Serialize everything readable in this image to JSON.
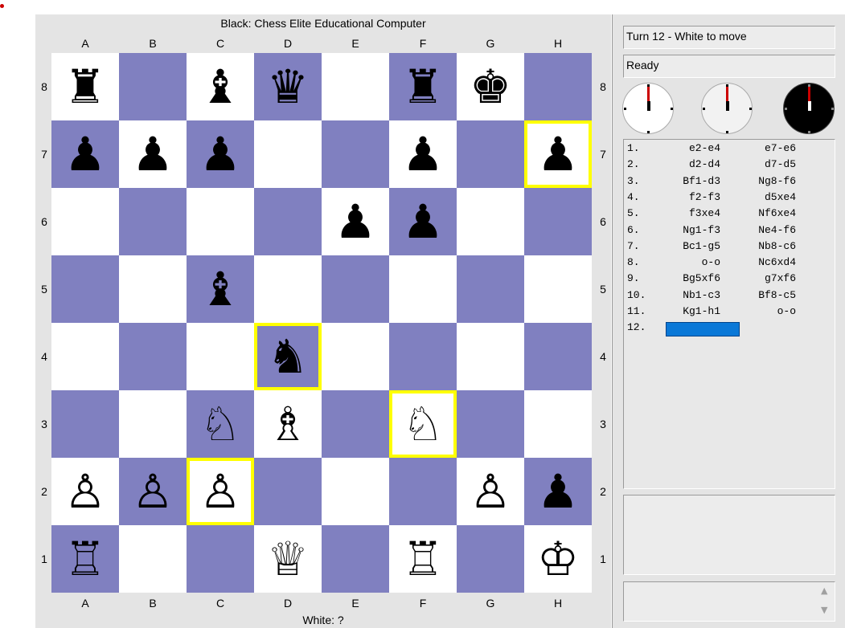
{
  "board": {
    "top_title": "Black: Chess Elite Educational Computer",
    "bottom_title": "White: ?",
    "files": [
      "A",
      "B",
      "C",
      "D",
      "E",
      "F",
      "G",
      "H"
    ],
    "ranks": [
      "8",
      "7",
      "6",
      "5",
      "4",
      "3",
      "2",
      "1"
    ],
    "colors": {
      "light": "#ffffff",
      "dark": "#8080c0",
      "highlight": "#ffff00"
    },
    "highlighted_squares": [
      "h7",
      "d4",
      "f3",
      "c2"
    ],
    "pieces": [
      {
        "square": "a8",
        "glyph": "♜",
        "piece": "black-rook"
      },
      {
        "square": "c8",
        "glyph": "♝",
        "piece": "black-bishop"
      },
      {
        "square": "d8",
        "glyph": "♛",
        "piece": "black-queen"
      },
      {
        "square": "f8",
        "glyph": "♜",
        "piece": "black-rook"
      },
      {
        "square": "g8",
        "glyph": "♚",
        "piece": "black-king"
      },
      {
        "square": "a7",
        "glyph": "♟",
        "piece": "black-pawn"
      },
      {
        "square": "b7",
        "glyph": "♟",
        "piece": "black-pawn"
      },
      {
        "square": "c7",
        "glyph": "♟",
        "piece": "black-pawn"
      },
      {
        "square": "f7",
        "glyph": "♟",
        "piece": "black-pawn"
      },
      {
        "square": "h7",
        "glyph": "♟",
        "piece": "black-pawn"
      },
      {
        "square": "e6",
        "glyph": "♟",
        "piece": "black-pawn"
      },
      {
        "square": "f6",
        "glyph": "♟",
        "piece": "black-pawn"
      },
      {
        "square": "c5",
        "glyph": "♝",
        "piece": "black-bishop"
      },
      {
        "square": "d4",
        "glyph": "♞",
        "piece": "black-knight"
      },
      {
        "square": "c3",
        "glyph": "♘",
        "piece": "white-knight"
      },
      {
        "square": "d3",
        "glyph": "♗",
        "piece": "white-bishop"
      },
      {
        "square": "f3",
        "glyph": "♘",
        "piece": "white-knight"
      },
      {
        "square": "a2",
        "glyph": "♙",
        "piece": "white-pawn"
      },
      {
        "square": "b2",
        "glyph": "♙",
        "piece": "white-pawn"
      },
      {
        "square": "c2",
        "glyph": "♙",
        "piece": "white-pawn"
      },
      {
        "square": "g2",
        "glyph": "♙",
        "piece": "white-pawn"
      },
      {
        "square": "h2",
        "glyph": "♟",
        "piece": "black-pawn"
      },
      {
        "square": "a1",
        "glyph": "♖",
        "piece": "white-rook"
      },
      {
        "square": "d1",
        "glyph": "♕",
        "piece": "white-queen"
      },
      {
        "square": "f1",
        "glyph": "♖",
        "piece": "white-rook"
      },
      {
        "square": "h1",
        "glyph": "♔",
        "piece": "white-king"
      }
    ]
  },
  "side": {
    "turn_text": "Turn 12 - White to move",
    "status_text": "Ready",
    "clocks": [
      "clock-icon",
      "clock-icon",
      "clock-icon"
    ],
    "moves": [
      {
        "num": "1.",
        "white": "e2-e4",
        "black": "e7-e6"
      },
      {
        "num": "2.",
        "white": "d2-d4",
        "black": "d7-d5"
      },
      {
        "num": "3.",
        "white": "Bf1-d3",
        "black": "Ng8-f6"
      },
      {
        "num": "4.",
        "white": "f2-f3",
        "black": "d5xe4"
      },
      {
        "num": "5.",
        "white": "f3xe4",
        "black": "Nf6xe4"
      },
      {
        "num": "6.",
        "white": "Ng1-f3",
        "black": "Ne4-f6"
      },
      {
        "num": "7.",
        "white": "Bc1-g5",
        "black": "Nb8-c6"
      },
      {
        "num": "8.",
        "white": "o-o",
        "black": "Nc6xd4"
      },
      {
        "num": "9.",
        "white": "Bg5xf6",
        "black": "g7xf6"
      },
      {
        "num": "10.",
        "white": "Nb1-c3",
        "black": "Bf8-c5"
      },
      {
        "num": "11.",
        "white": "Kg1-h1",
        "black": "o-o"
      },
      {
        "num": "12.",
        "white": "",
        "black": ""
      }
    ],
    "scroll_icons": [
      "chevron-up-icon",
      "chevron-down-icon"
    ]
  }
}
